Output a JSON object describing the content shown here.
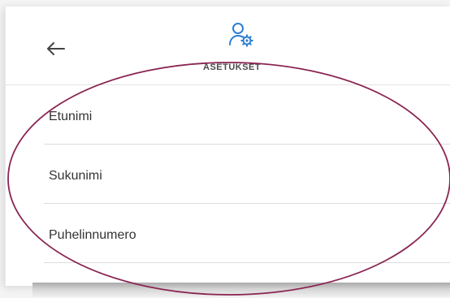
{
  "header": {
    "title": "ASETUKSET",
    "back_icon": "arrow-left-icon",
    "settings_icon": "user-gear-icon"
  },
  "fields": [
    {
      "label": "Etunimi"
    },
    {
      "label": "Sukunimi"
    },
    {
      "label": "Puhelinnumero"
    }
  ],
  "colors": {
    "accent": "#2e7fd0",
    "annotation": "#8a2452"
  }
}
